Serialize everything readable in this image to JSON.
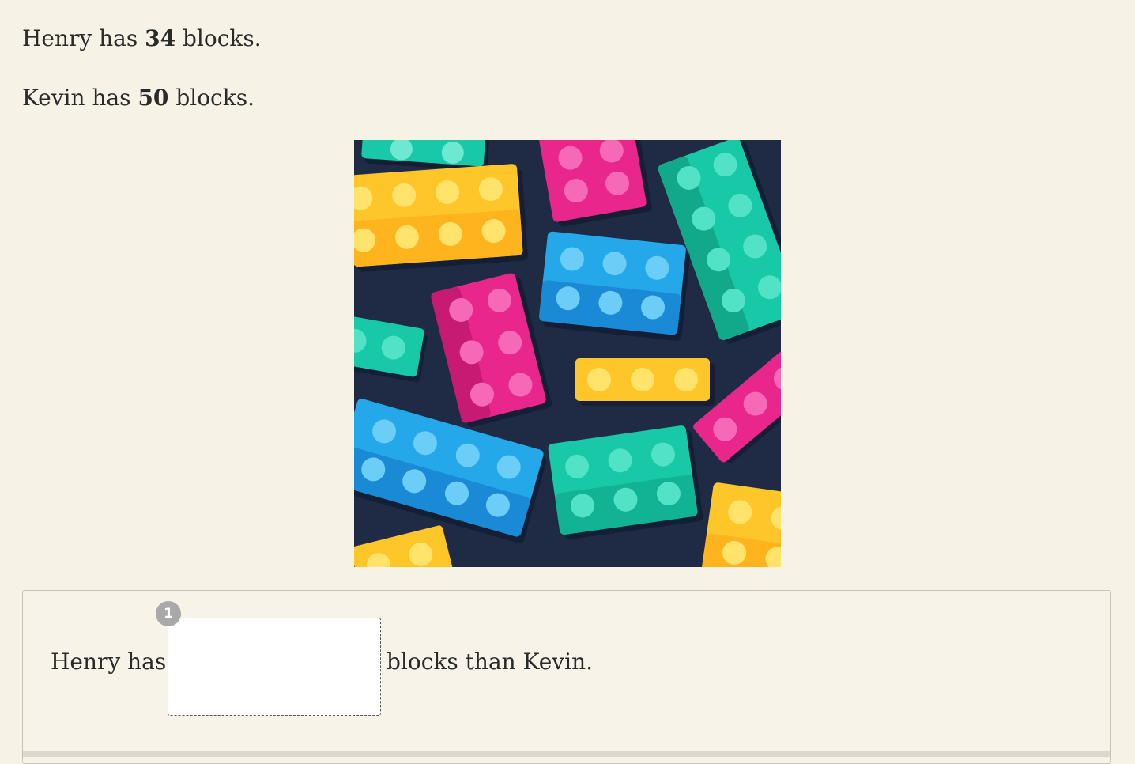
{
  "statements": {
    "henry": {
      "prefix": "Henry has ",
      "count": "34",
      "suffix": " blocks."
    },
    "kevin": {
      "prefix": "Kevin has ",
      "count": "50",
      "suffix": " blocks."
    }
  },
  "image": {
    "subject": "colorful toy building blocks",
    "colors": {
      "background": "#1f2a44",
      "yellow": "#ffc62a",
      "pink": "#e8268c",
      "blue": "#24a8ea",
      "teal": "#17c9a7"
    }
  },
  "answer": {
    "badge": "1",
    "prefix": "Henry has",
    "suffix": "blocks than Kevin.",
    "input_value": "",
    "input_placeholder": ""
  }
}
